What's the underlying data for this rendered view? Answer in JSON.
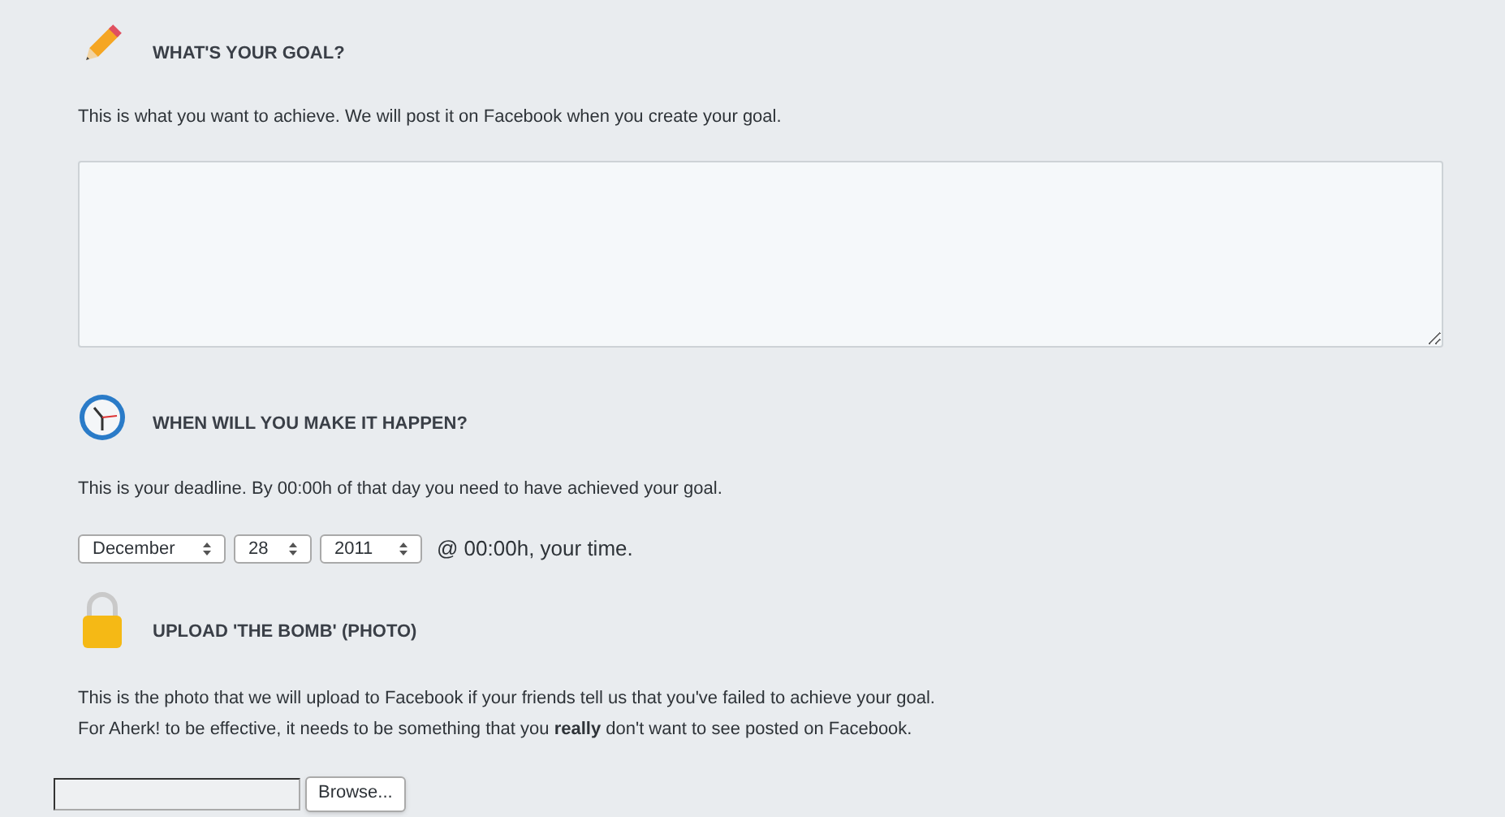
{
  "goal": {
    "heading": "WHAT'S YOUR GOAL?",
    "description": "This is what you want to achieve. We will post it on Facebook when you create your goal."
  },
  "deadline": {
    "heading": "WHEN WILL YOU MAKE IT HAPPEN?",
    "description": "This is your deadline. By 00:00h of that day you need to have achieved your goal.",
    "selects": [
      {
        "value": "December"
      },
      {
        "value": "28"
      },
      {
        "value": "2011"
      }
    ],
    "suffix": "@ 00:00h, your time."
  },
  "photo": {
    "heading": "UPLOAD 'THE BOMB' (PHOTO)",
    "description": [
      "This is the photo that we will upload to Facebook if your friends tell us that you've failed to achieve your goal.",
      "For Aherk! to be effective, it needs to be something that you **really** don't want to see posted on Facebook."
    ],
    "button": "Browse..."
  }
}
